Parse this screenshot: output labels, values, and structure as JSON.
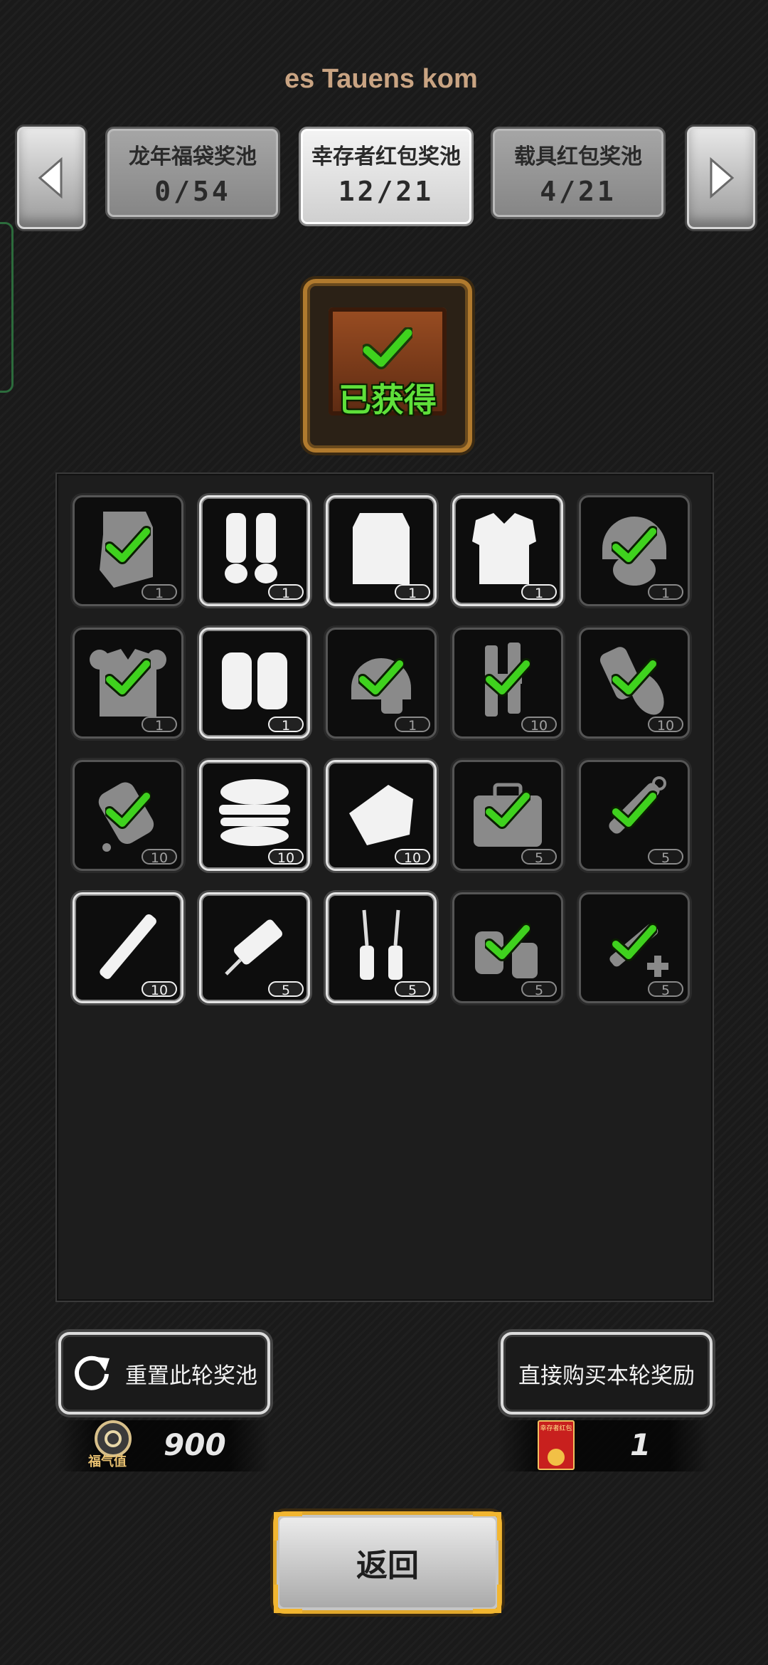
{
  "marquee": {
    "text": "es Tauens kom"
  },
  "pools": [
    {
      "name": "龙年福袋奖池",
      "count": "0/54"
    },
    {
      "name": "幸存者红包奖池",
      "count": "12/21"
    },
    {
      "name": "载具红包奖池",
      "count": "4/21"
    }
  ],
  "chest": {
    "label": "已获得"
  },
  "items": [
    {
      "icon": "riot-shield-icon",
      "count": "1",
      "obtained": true
    },
    {
      "icon": "shin-guards-icon",
      "count": "1",
      "obtained": false
    },
    {
      "icon": "ballistic-shield-icon",
      "count": "1",
      "obtained": false
    },
    {
      "icon": "body-armor-icon",
      "count": "1",
      "obtained": false
    },
    {
      "icon": "tactical-helmet-icon",
      "count": "1",
      "obtained": true
    },
    {
      "icon": "armor-vest-icon",
      "count": "1",
      "obtained": true
    },
    {
      "icon": "knee-pads-icon",
      "count": "1",
      "obtained": false
    },
    {
      "icon": "helmet-icon",
      "count": "1",
      "obtained": true
    },
    {
      "icon": "ammo-tubes-icon",
      "count": "10",
      "obtained": true
    },
    {
      "icon": "bandage-roll-icon",
      "count": "10",
      "obtained": true
    },
    {
      "icon": "spray-bottle-icon",
      "count": "10",
      "obtained": true
    },
    {
      "icon": "burger-icon",
      "count": "10",
      "obtained": false
    },
    {
      "icon": "meat-icon",
      "count": "10",
      "obtained": false
    },
    {
      "icon": "camo-bag-icon",
      "count": "5",
      "obtained": true
    },
    {
      "icon": "auto-injector-icon",
      "count": "5",
      "obtained": true
    },
    {
      "icon": "stick-icon",
      "count": "10",
      "obtained": false
    },
    {
      "icon": "syringe-icon",
      "count": "5",
      "obtained": false
    },
    {
      "icon": "ampoules-icon",
      "count": "5",
      "obtained": false
    },
    {
      "icon": "pill-bottles-icon",
      "count": "5",
      "obtained": true
    },
    {
      "icon": "medical-syringe-icon",
      "count": "5",
      "obtained": true
    }
  ],
  "buttons": {
    "reset": "重置此轮奖池",
    "buy": "直接购买本轮奖励",
    "back": "返回"
  },
  "currency": {
    "fortune_label": "福气值",
    "fortune_value": "900",
    "envelope_label": "幸存者红包",
    "envelope_value": "1"
  },
  "colors": {
    "check": "#3fd21e",
    "back_frame": "#e1a82c",
    "chest_frame": "#b07a2e",
    "marquee_text": "#c9a483"
  }
}
